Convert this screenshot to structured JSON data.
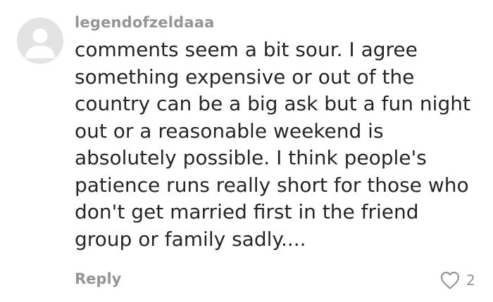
{
  "comment": {
    "username": "legendofzeldaaa",
    "avatar_icon": "user-avatar-icon",
    "lines": [
      "comments seem a bit sour. I agree",
      "something expensive or out of the",
      "country can be a big ask but a fun night",
      "out or a reasonable weekend is",
      "absolutely possible. I think people's",
      "patience runs really short for those who",
      "don't get married first in the friend",
      "group or family sadly...."
    ],
    "reply_label": "Reply",
    "like_icon": "heart-outline-icon",
    "like_count": "2"
  },
  "colors": {
    "meta_text": "#959595",
    "body_text": "#262626",
    "avatar_bg": "#e3e3e3",
    "avatar_fg": "#ffffff"
  }
}
